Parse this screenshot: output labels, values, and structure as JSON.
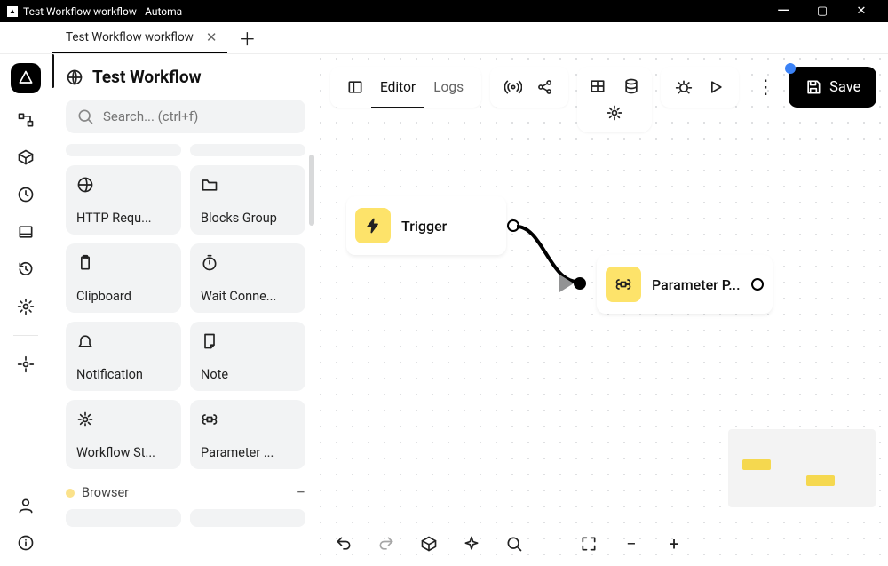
{
  "window": {
    "title": "Test Workflow workflow - Automa"
  },
  "tab": {
    "label": "Test Workflow workflow"
  },
  "workflow": {
    "title": "Test Workflow"
  },
  "search": {
    "placeholder": "Search... (ctrl+f)"
  },
  "blocks": [
    {
      "icon": "globe",
      "label": "HTTP Requ..."
    },
    {
      "icon": "folder",
      "label": "Blocks Group"
    },
    {
      "icon": "clipboard",
      "label": "Clipboard"
    },
    {
      "icon": "stopwatch",
      "label": "Wait Conne..."
    },
    {
      "icon": "bell",
      "label": "Notification"
    },
    {
      "icon": "note",
      "label": "Note"
    },
    {
      "icon": "gear",
      "label": "Workflow St..."
    },
    {
      "icon": "command",
      "label": "Parameter ..."
    }
  ],
  "section": {
    "name": "Browser"
  },
  "editor": {
    "tabs": {
      "editor": "Editor",
      "logs": "Logs"
    },
    "save": "Save"
  },
  "nodes": {
    "trigger": {
      "label": "Trigger"
    },
    "param": {
      "label": "Parameter P..."
    }
  }
}
